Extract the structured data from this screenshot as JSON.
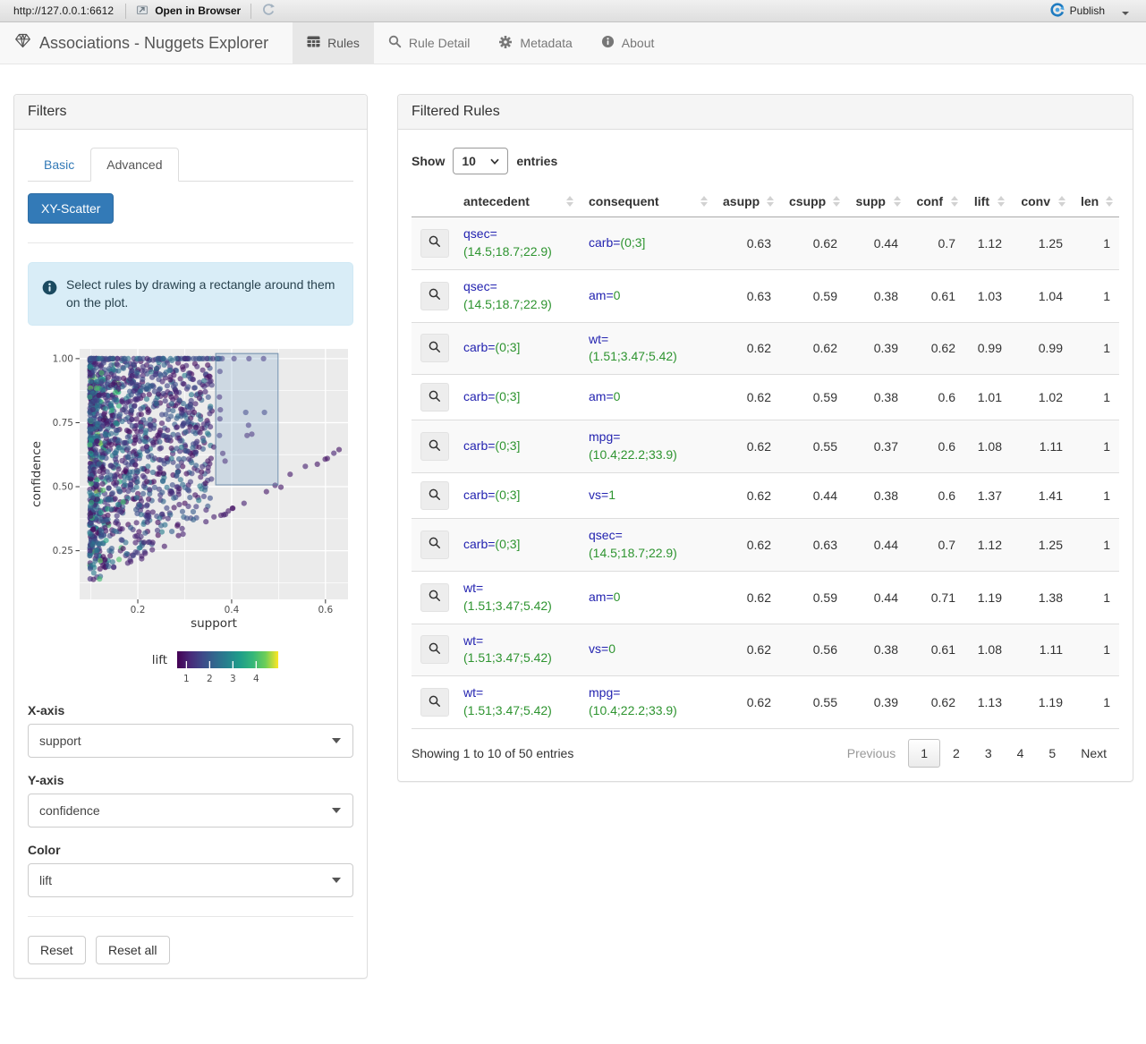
{
  "topbar": {
    "url": "http://127.0.0.1:6612",
    "open_in_browser": "Open in Browser",
    "publish": "Publish"
  },
  "navbar": {
    "brand": "Associations - Nuggets Explorer",
    "tabs": [
      {
        "label": "Rules",
        "icon": "table-icon",
        "active": true
      },
      {
        "label": "Rule Detail",
        "icon": "search-icon",
        "active": false
      },
      {
        "label": "Metadata",
        "icon": "gear-icon",
        "active": false
      },
      {
        "label": "About",
        "icon": "info-icon",
        "active": false
      }
    ]
  },
  "filters": {
    "title": "Filters",
    "tabs": {
      "basic": "Basic",
      "advanced": "Advanced"
    },
    "scatter_button": "XY-Scatter",
    "alert": "Select rules by drawing a rectangle around them on the plot.",
    "controls": [
      {
        "label": "X-axis",
        "value": "support"
      },
      {
        "label": "Y-axis",
        "value": "confidence"
      },
      {
        "label": "Color",
        "value": "lift"
      }
    ],
    "reset": "Reset",
    "reset_all": "Reset all"
  },
  "chart_data": {
    "type": "scatter",
    "xlabel": "support",
    "ylabel": "confidence",
    "x_ticks": [
      0.2,
      0.4,
      0.6
    ],
    "y_ticks": [
      0.25,
      0.5,
      0.75,
      1.0
    ],
    "x_range": [
      0.076,
      0.648
    ],
    "y_range": [
      0.06,
      1.038
    ],
    "grid": true,
    "panel_bg": "#ebebeb",
    "point_style": {
      "radius": 3.1,
      "opacity": 0.62
    },
    "color_legend": {
      "label": "lift",
      "ticks": [
        1,
        2,
        3,
        4
      ],
      "range": [
        0.6,
        4.95
      ],
      "colormap": "viridis"
    },
    "selection_rect": {
      "x": [
        0.366,
        0.499
      ],
      "y": [
        0.507,
        1.02
      ]
    },
    "points": {
      "note": "dense cloud of ~1600 association rules approximated with a seeded generator; sparse readable points listed in extra as [support, confidence, lift]",
      "seed": 20240817,
      "wedge": {
        "n": 1450,
        "x_min": 0.098,
        "x_span": 0.26,
        "x_pow": 2.0,
        "y_pow": 0.75,
        "lift_base": 0.75,
        "lift_span": 1.9,
        "green_frac": 0.12,
        "green_x_max": 0.17,
        "green_lift": [
          2.6,
          4.6
        ]
      },
      "top_row": {
        "n": 70,
        "y": 1.0,
        "x_min": 0.1,
        "x_span": 0.28,
        "x_pow": 1.7,
        "lift": [
          0.9,
          2.5
        ]
      },
      "diagonal": {
        "n": 26,
        "x_min": 0.16,
        "x_span": 0.47,
        "y_offset": 0.005,
        "y_jitter": 0.02,
        "lift": [
          0.85,
          1.1
        ]
      },
      "extra": [
        [
          0.405,
          1.0,
          1.15
        ],
        [
          0.437,
          1.0,
          1.2
        ],
        [
          0.468,
          1.0,
          1.2
        ],
        [
          0.34,
          1.0,
          1.6
        ],
        [
          0.36,
          1.0,
          1.3
        ],
        [
          0.375,
          0.95,
          1.3
        ],
        [
          0.374,
          0.85,
          1.05
        ],
        [
          0.376,
          0.8,
          1.1
        ],
        [
          0.375,
          0.765,
          1.2
        ],
        [
          0.374,
          0.7,
          1.35
        ],
        [
          0.381,
          0.63,
          1.0
        ],
        [
          0.386,
          0.6,
          0.95
        ],
        [
          0.43,
          0.79,
          1.45
        ],
        [
          0.436,
          0.74,
          1.2
        ],
        [
          0.433,
          0.7,
          1.0
        ],
        [
          0.443,
          0.705,
          1.05
        ],
        [
          0.47,
          0.79,
          1.5
        ],
        [
          0.505,
          0.498,
          0.9
        ],
        [
          0.362,
          0.655,
          1.0
        ],
        [
          0.356,
          0.61,
          0.95
        ],
        [
          0.35,
          0.575,
          1.05
        ]
      ]
    }
  },
  "rules": {
    "title": "Filtered Rules",
    "show_label": "Show",
    "entries_label": "entries",
    "page_length": "10",
    "columns": [
      "antecedent",
      "consequent",
      "asupp",
      "csupp",
      "supp",
      "conf",
      "lift",
      "conv",
      "len"
    ],
    "rows": [
      {
        "antecedent": {
          "attr": "qsec=",
          "val": "(14.5;18.7;22.9)"
        },
        "consequent": {
          "attr": "carb=",
          "val": "(0;3]"
        },
        "asupp": "0.63",
        "csupp": "0.62",
        "supp": "0.44",
        "conf": "0.7",
        "lift": "1.12",
        "conv": "1.25",
        "len": "1"
      },
      {
        "antecedent": {
          "attr": "qsec=",
          "val": "(14.5;18.7;22.9)"
        },
        "consequent": {
          "attr": "am=",
          "val": "0"
        },
        "asupp": "0.63",
        "csupp": "0.59",
        "supp": "0.38",
        "conf": "0.61",
        "lift": "1.03",
        "conv": "1.04",
        "len": "1"
      },
      {
        "antecedent": {
          "attr": "carb=",
          "val": "(0;3]"
        },
        "consequent": {
          "attr": "wt=",
          "val": "(1.51;3.47;5.42)"
        },
        "asupp": "0.62",
        "csupp": "0.62",
        "supp": "0.39",
        "conf": "0.62",
        "lift": "0.99",
        "conv": "0.99",
        "len": "1"
      },
      {
        "antecedent": {
          "attr": "carb=",
          "val": "(0;3]"
        },
        "consequent": {
          "attr": "am=",
          "val": "0"
        },
        "asupp": "0.62",
        "csupp": "0.59",
        "supp": "0.38",
        "conf": "0.6",
        "lift": "1.01",
        "conv": "1.02",
        "len": "1"
      },
      {
        "antecedent": {
          "attr": "carb=",
          "val": "(0;3]"
        },
        "consequent": {
          "attr": "mpg=",
          "val": "(10.4;22.2;33.9)"
        },
        "asupp": "0.62",
        "csupp": "0.55",
        "supp": "0.37",
        "conf": "0.6",
        "lift": "1.08",
        "conv": "1.11",
        "len": "1"
      },
      {
        "antecedent": {
          "attr": "carb=",
          "val": "(0;3]"
        },
        "consequent": {
          "attr": "vs=",
          "val": "1"
        },
        "asupp": "0.62",
        "csupp": "0.44",
        "supp": "0.38",
        "conf": "0.6",
        "lift": "1.37",
        "conv": "1.41",
        "len": "1"
      },
      {
        "antecedent": {
          "attr": "carb=",
          "val": "(0;3]"
        },
        "consequent": {
          "attr": "qsec=",
          "val": "(14.5;18.7;22.9)"
        },
        "asupp": "0.62",
        "csupp": "0.63",
        "supp": "0.44",
        "conf": "0.7",
        "lift": "1.12",
        "conv": "1.25",
        "len": "1"
      },
      {
        "antecedent": {
          "attr": "wt=",
          "val": "(1.51;3.47;5.42)"
        },
        "consequent": {
          "attr": "am=",
          "val": "0"
        },
        "asupp": "0.62",
        "csupp": "0.59",
        "supp": "0.44",
        "conf": "0.71",
        "lift": "1.19",
        "conv": "1.38",
        "len": "1"
      },
      {
        "antecedent": {
          "attr": "wt=",
          "val": "(1.51;3.47;5.42)"
        },
        "consequent": {
          "attr": "vs=",
          "val": "0"
        },
        "asupp": "0.62",
        "csupp": "0.56",
        "supp": "0.38",
        "conf": "0.61",
        "lift": "1.08",
        "conv": "1.11",
        "len": "1"
      },
      {
        "antecedent": {
          "attr": "wt=",
          "val": "(1.51;3.47;5.42)"
        },
        "consequent": {
          "attr": "mpg=",
          "val": "(10.4;22.2;33.9)"
        },
        "asupp": "0.62",
        "csupp": "0.55",
        "supp": "0.39",
        "conf": "0.62",
        "lift": "1.13",
        "conv": "1.19",
        "len": "1"
      }
    ],
    "info": "Showing 1 to 10 of 50 entries",
    "pagination": {
      "previous": "Previous",
      "pages": [
        "1",
        "2",
        "3",
        "4",
        "5"
      ],
      "active": "1",
      "next": "Next"
    }
  }
}
